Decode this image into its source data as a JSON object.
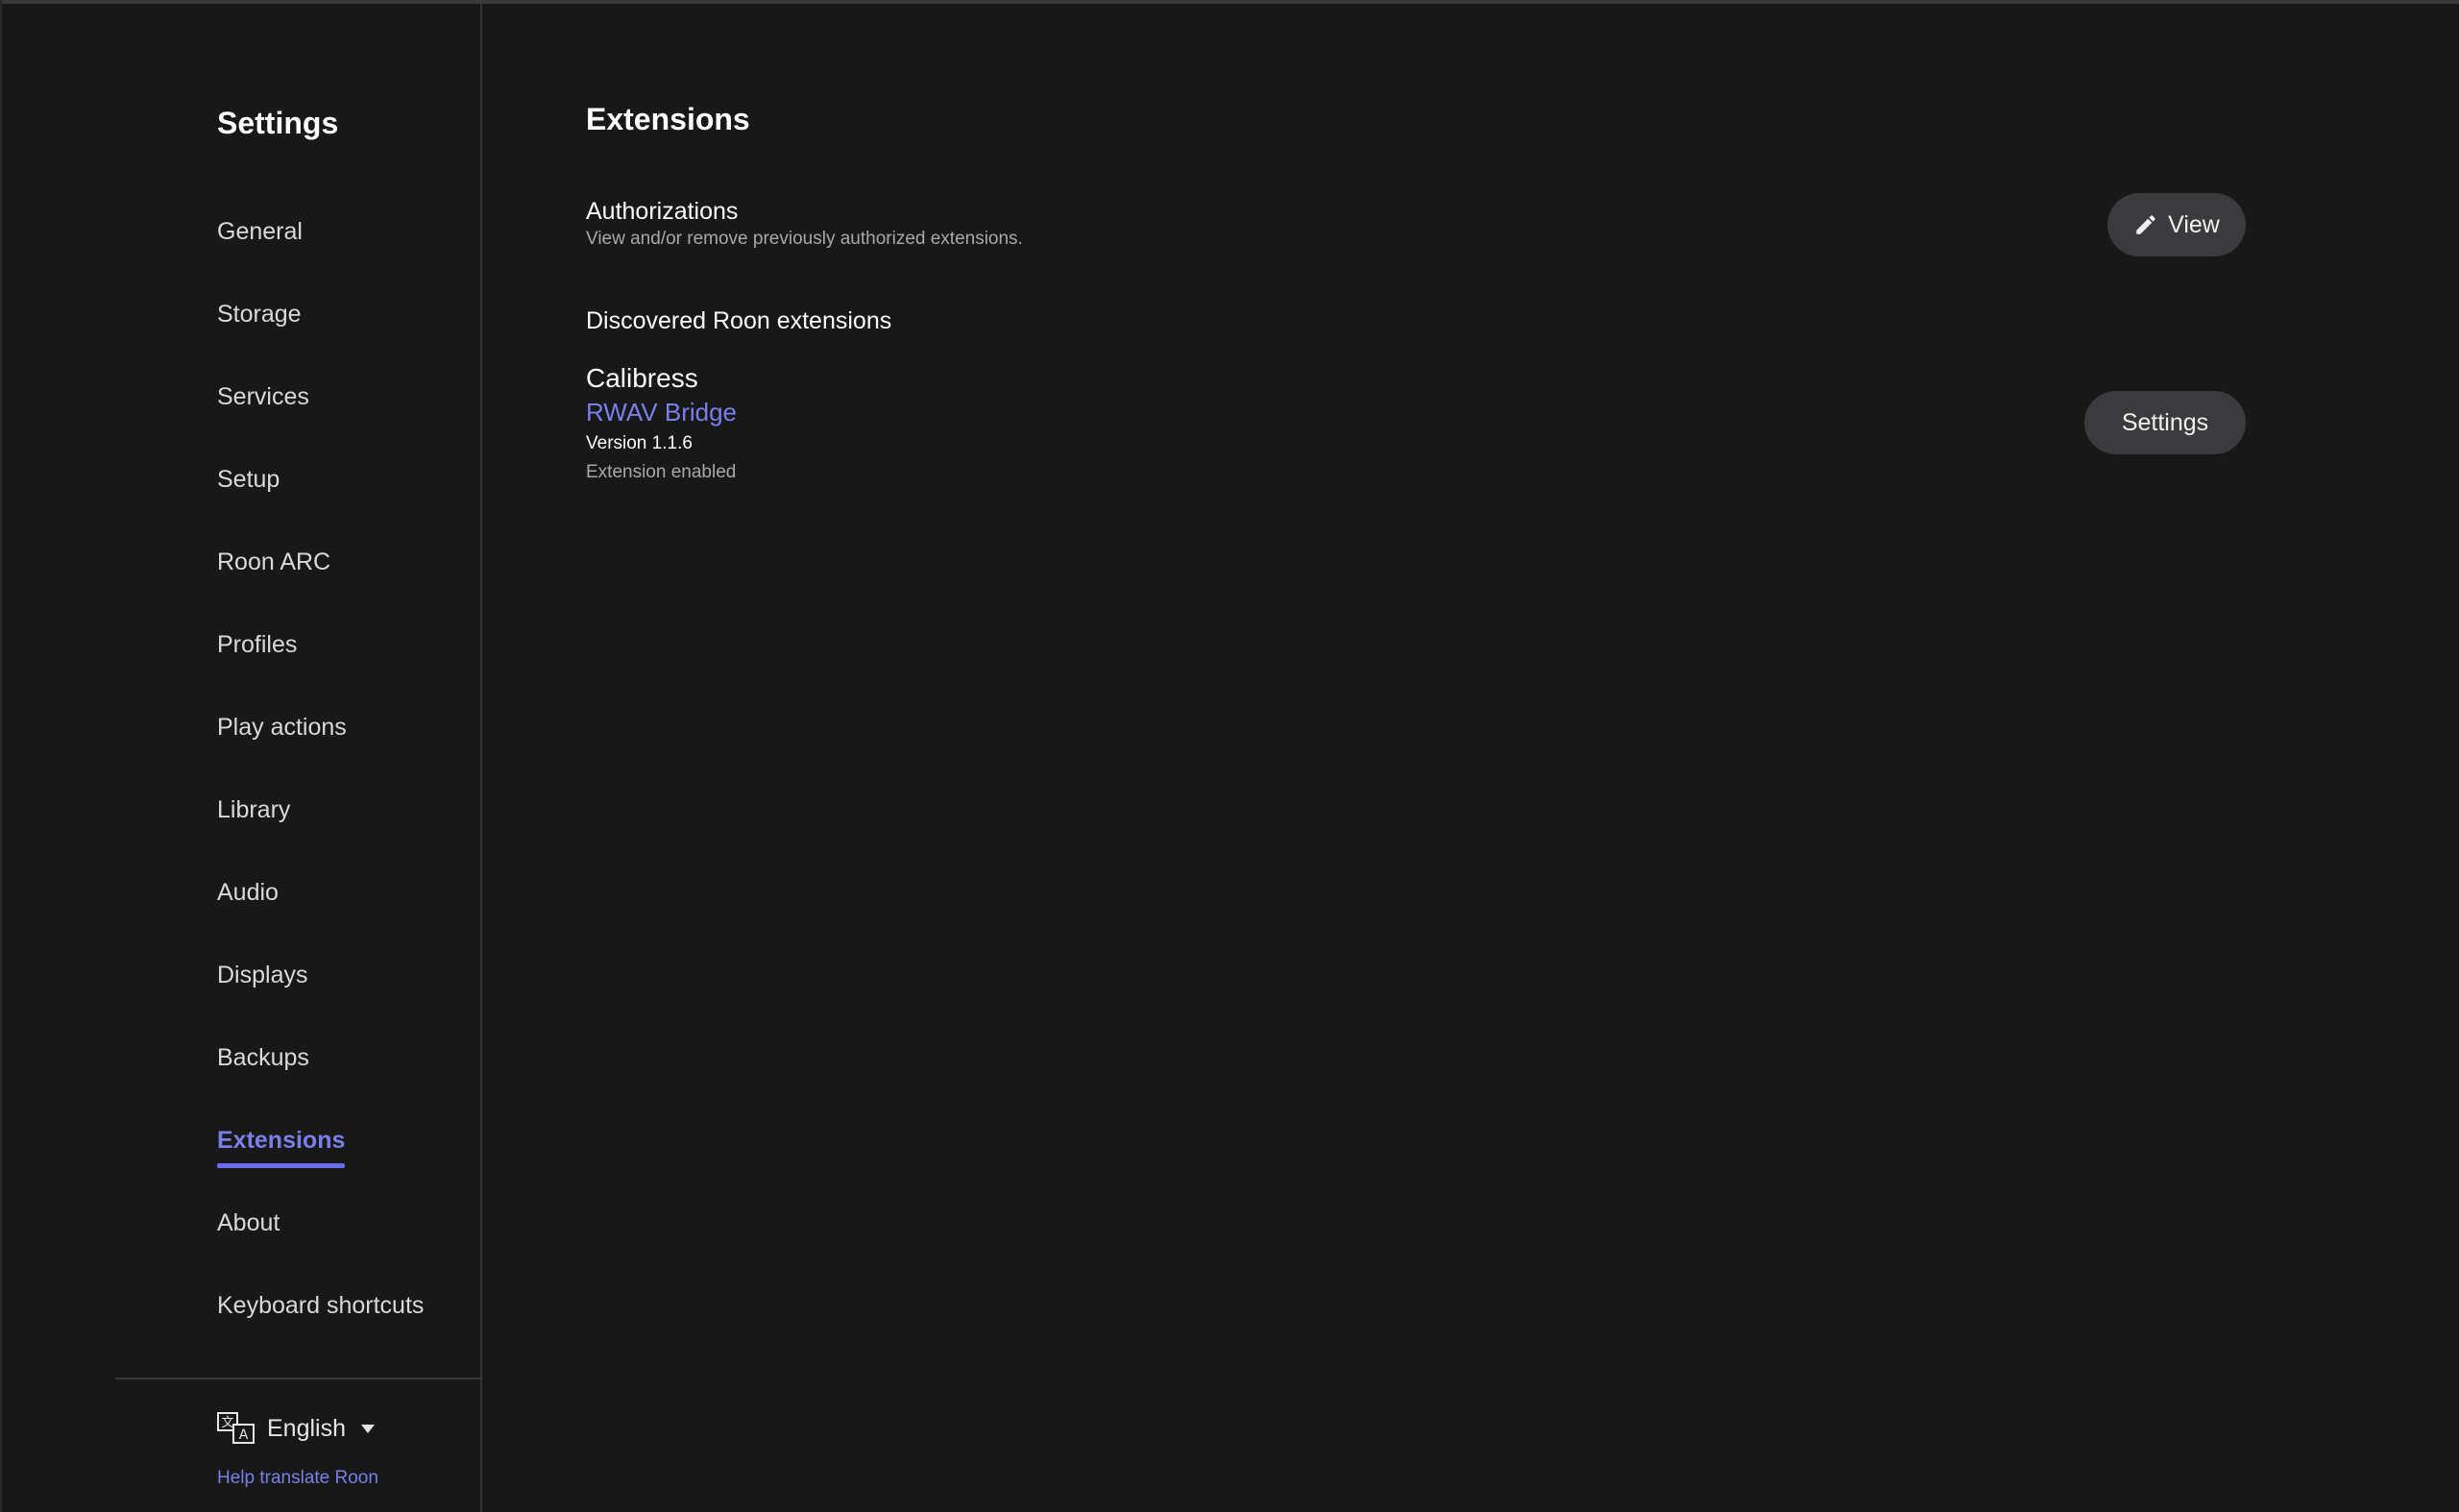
{
  "sidebar": {
    "title": "Settings",
    "items": [
      {
        "id": "general",
        "label": "General"
      },
      {
        "id": "storage",
        "label": "Storage"
      },
      {
        "id": "services",
        "label": "Services"
      },
      {
        "id": "setup",
        "label": "Setup"
      },
      {
        "id": "roon-arc",
        "label": "Roon ARC"
      },
      {
        "id": "profiles",
        "label": "Profiles"
      },
      {
        "id": "play-actions",
        "label": "Play actions"
      },
      {
        "id": "library",
        "label": "Library"
      },
      {
        "id": "audio",
        "label": "Audio"
      },
      {
        "id": "displays",
        "label": "Displays"
      },
      {
        "id": "backups",
        "label": "Backups"
      },
      {
        "id": "extensions",
        "label": "Extensions",
        "active": true
      },
      {
        "id": "about",
        "label": "About"
      },
      {
        "id": "keyboard-shortcuts",
        "label": "Keyboard shortcuts"
      }
    ],
    "language": {
      "label": "English",
      "icon": "translate-icon"
    },
    "help_link": "Help translate Roon"
  },
  "main": {
    "title": "Extensions",
    "authorizations": {
      "title": "Authorizations",
      "description": "View and/or remove previously authorized extensions.",
      "button_label": "View",
      "button_icon": "pencil-icon"
    },
    "discovered_heading": "Discovered Roon extensions",
    "extension": {
      "vendor": "Calibress",
      "name": "RWAV Bridge",
      "version": "Version 1.1.6",
      "status": "Extension enabled",
      "button_label": "Settings"
    }
  },
  "colors": {
    "background": "#181818",
    "accent": "#7b7fe8",
    "button": "#3b3b3d"
  }
}
